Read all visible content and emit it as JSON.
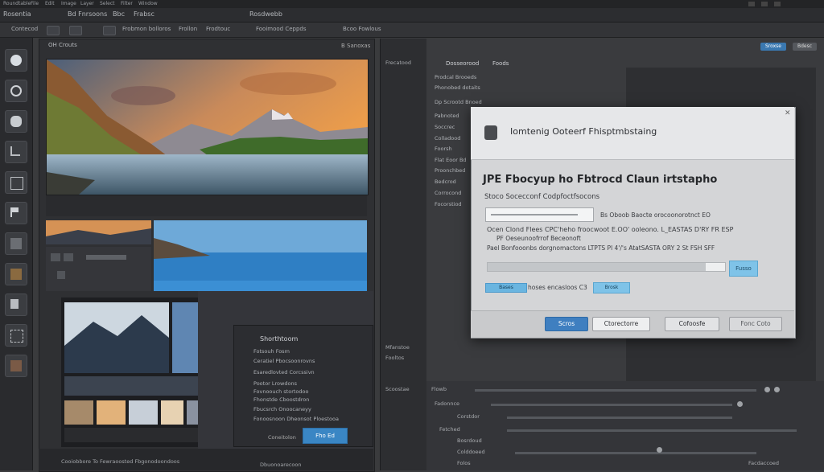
{
  "menubar": {
    "items": [
      "Roundtable",
      "File",
      "Edit",
      "Image",
      "Layer",
      "Select",
      "Filter",
      "Window"
    ]
  },
  "appbar": {
    "items": [
      "Rosentia",
      "Bd Fnrsoons",
      "Bbc",
      "Frabsc"
    ],
    "center_title": "Rosdwebb"
  },
  "optbar": {
    "items": [
      "Contecod",
      "Frobmon bolloros",
      "Frollon",
      "Frodtouc",
      "Fooimood Ceppds",
      "Bcoo Fowlous"
    ]
  },
  "doc": {
    "tab": "OH Crouts",
    "tab2": "B Sanoxas"
  },
  "side": {
    "title": "Frecatood",
    "rows": [
      "Mfanstoe",
      "Fooltos",
      "Scoostae"
    ]
  },
  "layers": {
    "header": "Dosseorood",
    "header2": "Foods",
    "rows": [
      "Prodcal Brooeds",
      "Phonobed dotaits",
      "Dp Scrootd Bnoed",
      "Pabnoted",
      "Soccrec",
      "Colladood",
      "Foorsh",
      "Flat Eoor Bd",
      "Proonchbed",
      "Bedcrod",
      "Corrocond",
      "Focorstiod"
    ],
    "lower": [
      "Flowb",
      "Fadonnce",
      "Corstdor",
      "Fetched",
      "Bosrdoud",
      "Colddoeed",
      "Folos",
      "Facdaccoed"
    ]
  },
  "topright": {
    "primary": "Sroxse",
    "secondary": "Bdesc"
  },
  "subdialog": {
    "title": "Shorthtoom",
    "rows": [
      "Fotsouh Fosm",
      "Ceratiel Pbocsoonrovns",
      "Esaredlovted Corcssivn",
      "Pootor Lrowdons",
      "Fovnoouch stortodoo",
      "Fhonstde Cboostdron",
      "Fbucsrch Onoocaneyy",
      "Fonoosnoon Dheonsot Ploestooa"
    ],
    "button": "Fho Ed",
    "footer": "Coneitolon"
  },
  "bottom": {
    "left": "Cooiobbore To Fewraoosted Fbgonodoondoos",
    "left2": "Dbuonoarecoon"
  },
  "dialog": {
    "title": "Iomtenig Ooteerf Fhisptmbstaing",
    "heading": "JPE Fbocyup ho Fbtrocd Claun irtstapho",
    "subheading": "Stoco Socecconf Codpfoctfsocons",
    "field_note": "Bs Oboob Baocte orocoonorotnct EO",
    "line2": "Ocen Clond Flees CPC'heho froocwoot E.OO' ooleono. L_EASTAS D'RY FR ESP",
    "line3": "PF Oeseunoofrrof Beceonoft",
    "line4": "Pael Bonfooonbs dorgnomactons LTPTS Pl 4'/'s AtatSASTA ORY 2 St FSH SFF",
    "progress_button": "Fusso",
    "progress": 0.92,
    "check_label": "Bases",
    "check_text": "hoses encasloos C3",
    "check_label2": "Brosk",
    "buttons": {
      "ok": "Scros",
      "convert": "Ctorectorre",
      "options": "Cofoosfe",
      "cancel": "Fonc Coto"
    }
  },
  "colors": {
    "accent": "#3f7fc0",
    "dialog_bg": "#d4d5d7",
    "panel_bg": "#3a3b3d"
  }
}
